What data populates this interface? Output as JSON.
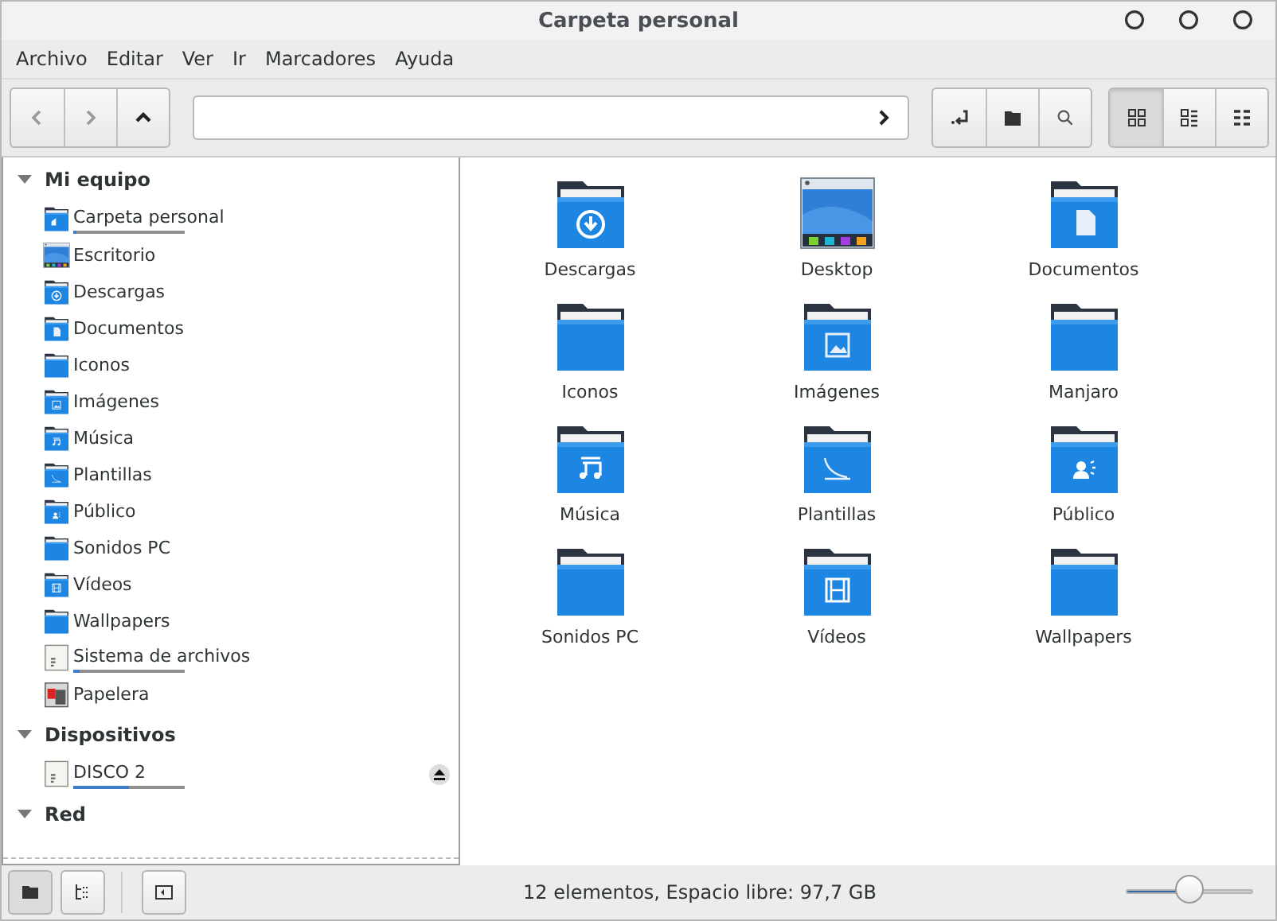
{
  "window": {
    "title": "Carpeta personal"
  },
  "menu": [
    "Archivo",
    "Editar",
    "Ver",
    "Ir",
    "Marcadores",
    "Ayuda"
  ],
  "toolbar": {
    "nav": [
      {
        "kind": "back",
        "disabled": true
      },
      {
        "kind": "forward",
        "disabled": true
      },
      {
        "kind": "up",
        "disabled": false
      }
    ],
    "actions": [
      {
        "kind": "bookmark"
      },
      {
        "kind": "folder"
      },
      {
        "kind": "search"
      }
    ],
    "views": [
      {
        "kind": "icons",
        "selected": true
      },
      {
        "kind": "compact",
        "selected": false
      },
      {
        "kind": "list",
        "selected": false
      }
    ]
  },
  "sidebar": {
    "sections": [
      {
        "title": "Mi equipo",
        "expanded": true,
        "items": [
          {
            "label": "Carpeta personal",
            "kind": "home",
            "level": 0.03
          },
          {
            "label": "Escritorio",
            "kind": "desktop"
          },
          {
            "label": "Descargas",
            "kind": "download"
          },
          {
            "label": "Documentos",
            "kind": "document"
          },
          {
            "label": "Iconos",
            "kind": "plain"
          },
          {
            "label": "Imágenes",
            "kind": "image"
          },
          {
            "label": "Música",
            "kind": "music"
          },
          {
            "label": "Plantillas",
            "kind": "template"
          },
          {
            "label": "Público",
            "kind": "public"
          },
          {
            "label": "Sonidos PC",
            "kind": "plain"
          },
          {
            "label": "Vídeos",
            "kind": "video"
          },
          {
            "label": "Wallpapers",
            "kind": "plain"
          },
          {
            "label": "Sistema de archivos",
            "kind": "drive",
            "level": 0.06
          },
          {
            "label": "Papelera",
            "kind": "trash"
          }
        ]
      },
      {
        "title": "Dispositivos",
        "expanded": true,
        "items": [
          {
            "label": "DISCO 2",
            "kind": "drive",
            "level": 0.5,
            "eject": true
          }
        ]
      },
      {
        "title": "Red",
        "expanded": true
      }
    ]
  },
  "files": [
    {
      "label": "Descargas",
      "kind": "download"
    },
    {
      "label": "Desktop",
      "kind": "desktop"
    },
    {
      "label": "Documentos",
      "kind": "document"
    },
    {
      "label": "Iconos",
      "kind": "plain"
    },
    {
      "label": "Imágenes",
      "kind": "image"
    },
    {
      "label": "Manjaro",
      "kind": "plain"
    },
    {
      "label": "Música",
      "kind": "music"
    },
    {
      "label": "Plantillas",
      "kind": "template"
    },
    {
      "label": "Público",
      "kind": "public"
    },
    {
      "label": "Sonidos PC",
      "kind": "plain"
    },
    {
      "label": "Vídeos",
      "kind": "video"
    },
    {
      "label": "Wallpapers",
      "kind": "plain"
    }
  ],
  "status_bar": {
    "panes": [
      {
        "kind": "places",
        "selected": true
      },
      {
        "kind": "tree",
        "selected": false
      }
    ],
    "text": "12 elementos, Espacio libre: 97,7 GB",
    "zoom": {
      "level": 0.5
    }
  }
}
